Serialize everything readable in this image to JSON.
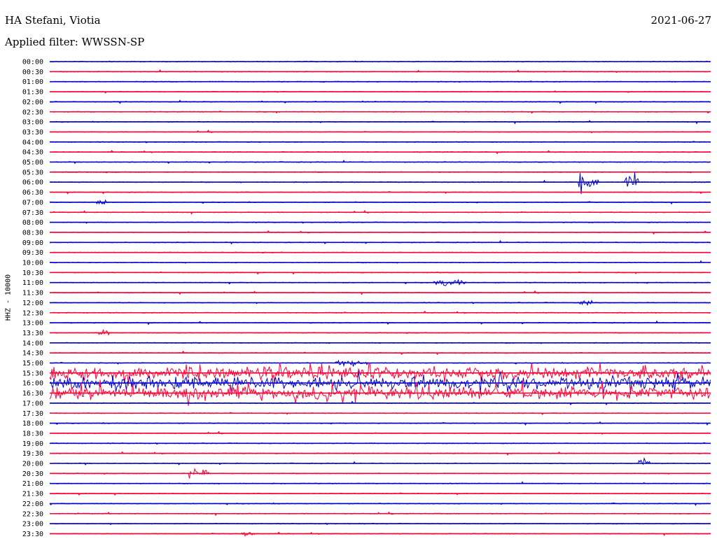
{
  "header": {
    "station": "HA Stefani, Viotia",
    "filter": "Applied filter: WWSSN-SP",
    "date": "2021-06-27"
  },
  "chart_data": {
    "type": "line",
    "title": "HA Stefani, Viotia",
    "subtitle": "Applied filter: WWSSN-SP",
    "ylabel": "HHZ - 10000",
    "xlabel": "",
    "date": "2021-06-27",
    "colors": {
      "even_hour": "#0000cc",
      "half_hour": "#ff0033"
    },
    "rows": [
      "00:00",
      "00:30",
      "01:00",
      "01:30",
      "02:00",
      "02:30",
      "03:00",
      "03:30",
      "04:00",
      "04:30",
      "05:00",
      "05:30",
      "06:00",
      "06:30",
      "07:00",
      "07:30",
      "08:00",
      "08:30",
      "09:00",
      "09:30",
      "10:00",
      "10:30",
      "11:00",
      "11:30",
      "12:00",
      "12:30",
      "13:00",
      "13:30",
      "14:00",
      "14:30",
      "15:00",
      "15:30",
      "16:00",
      "16:30",
      "17:00",
      "17:30",
      "18:00",
      "18:30",
      "19:00",
      "19:30",
      "20:00",
      "20:30",
      "21:00",
      "21:30",
      "22:00",
      "22:30",
      "23:00",
      "23:30"
    ],
    "activity": [
      {
        "row": "06:00",
        "range": [
          0.8,
          0.83
        ],
        "level": "strong"
      },
      {
        "row": "06:00",
        "range": [
          0.87,
          0.89
        ],
        "level": "strong"
      },
      {
        "row": "07:00",
        "range": [
          0.07,
          0.09
        ],
        "level": "moderate"
      },
      {
        "row": "11:00",
        "range": [
          0.58,
          0.63
        ],
        "level": "moderate"
      },
      {
        "row": "12:00",
        "range": [
          0.8,
          0.82
        ],
        "level": "moderate"
      },
      {
        "row": "13:30",
        "range": [
          0.07,
          0.09
        ],
        "level": "moderate"
      },
      {
        "row": "15:00",
        "range": [
          0.43,
          0.48
        ],
        "level": "moderate"
      },
      {
        "row": "15:30",
        "range": [
          0.0,
          1.0
        ],
        "level": "strong"
      },
      {
        "row": "16:00",
        "range": [
          0.0,
          1.0
        ],
        "level": "strong"
      },
      {
        "row": "16:30",
        "range": [
          0.0,
          1.0
        ],
        "level": "strong"
      },
      {
        "row": "20:00",
        "range": [
          0.89,
          0.91
        ],
        "level": "moderate"
      },
      {
        "row": "20:30",
        "range": [
          0.21,
          0.24
        ],
        "level": "moderate"
      },
      {
        "row": "23:30",
        "range": [
          0.29,
          0.31
        ],
        "level": "moderate"
      }
    ],
    "grid": false,
    "legend": "none"
  }
}
